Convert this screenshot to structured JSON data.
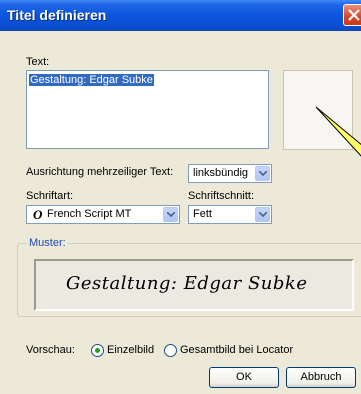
{
  "window": {
    "title": "Titel definieren"
  },
  "text_section": {
    "label": "Text:",
    "value": "Gestaltung: Edgar Subke"
  },
  "alignment": {
    "label": "Ausrichtung mehrzeiliger Text:",
    "value": "linksbündig"
  },
  "font": {
    "label": "Schriftart:",
    "value": "French Script MT",
    "icon_glyph": "O"
  },
  "style": {
    "label": "Schriftschnitt:",
    "value": "Fett"
  },
  "sample": {
    "legend": "Muster:",
    "text": "Gestaltung: Edgar Subke"
  },
  "preview": {
    "label": "Vorschau:",
    "options": [
      {
        "label": "Einzelbild",
        "checked": true
      },
      {
        "label": "Gesamtbild bei Locator",
        "checked": false
      }
    ]
  },
  "buttons": {
    "ok": "OK",
    "cancel": "Abbruch"
  },
  "colors": {
    "title_bar": "#0a56dc",
    "selection": "#316ac5",
    "legend": "#1e4bb8",
    "callout": "#ffff66"
  }
}
